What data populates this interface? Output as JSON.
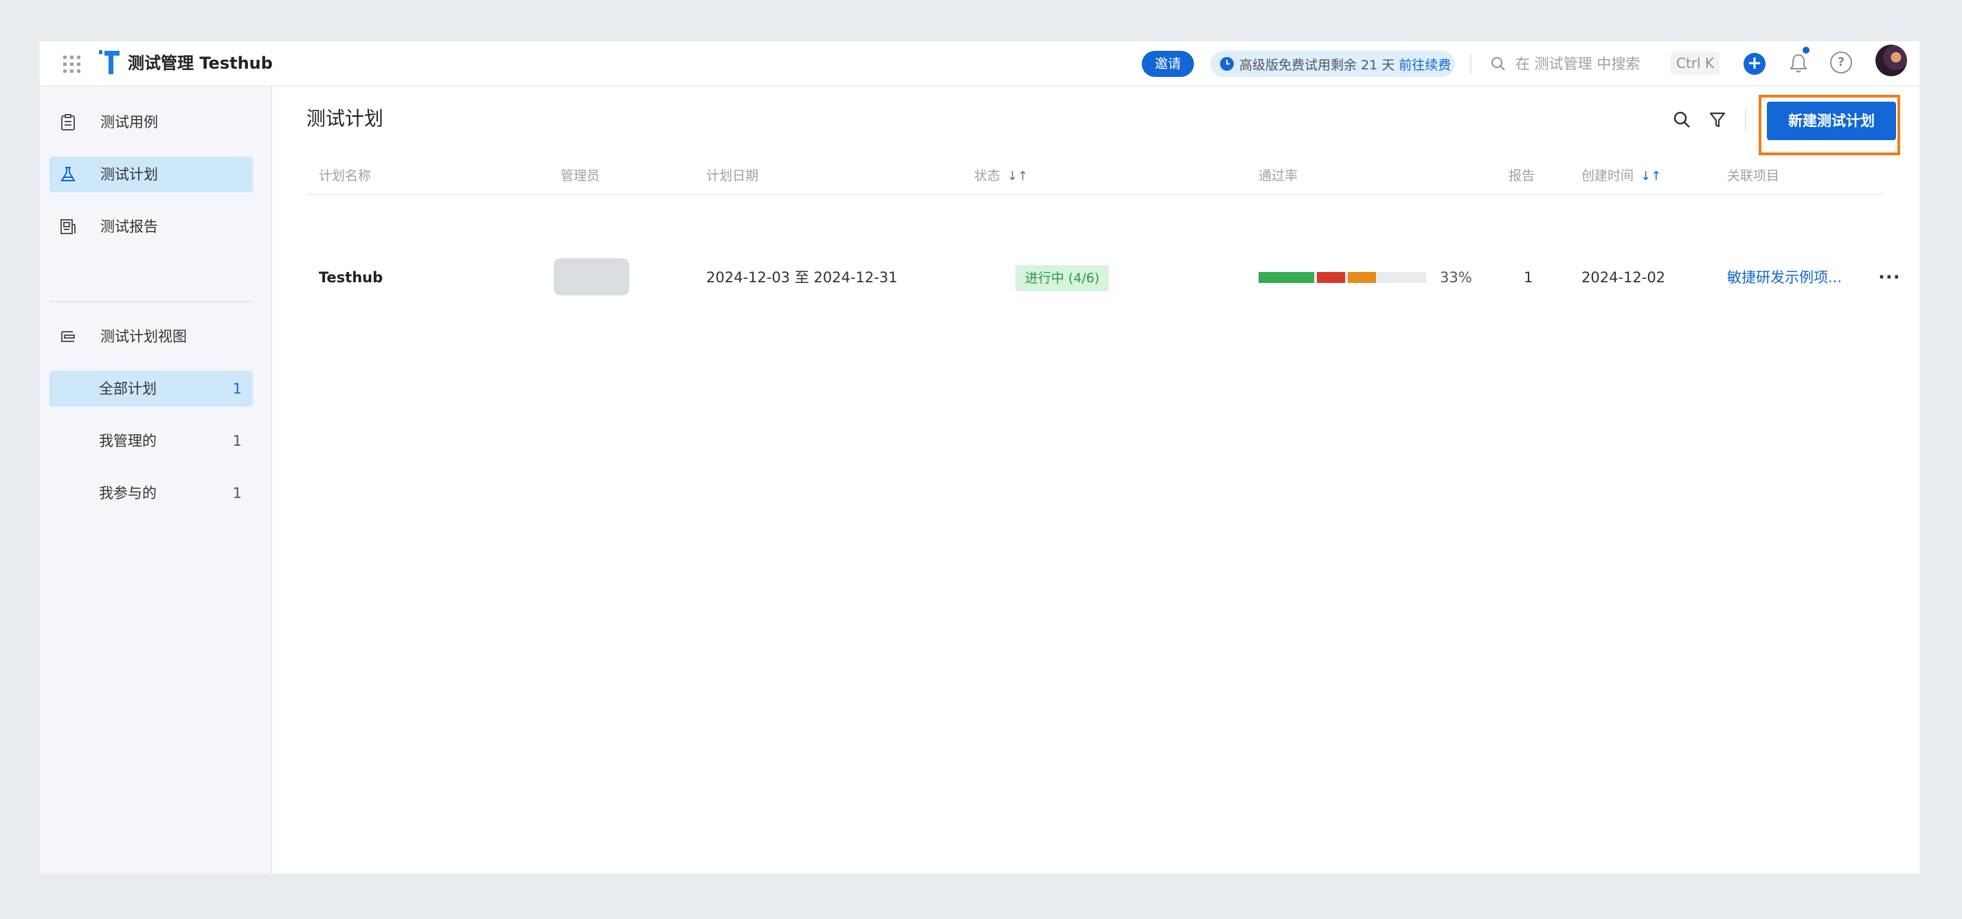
{
  "header": {
    "app_title": "测试管理 Testhub",
    "invite_label": "邀请",
    "trial_text": "高级版免费试用剩余 21 天",
    "trial_link": "前往续费",
    "search_placeholder": "在 测试管理 中搜索",
    "shortcut": "Ctrl K",
    "accent_color": "#1266d6"
  },
  "sidebar": {
    "items": [
      {
        "label": "测试用例",
        "icon": "clipboard-icon"
      },
      {
        "label": "测试计划",
        "icon": "flask-icon"
      },
      {
        "label": "测试报告",
        "icon": "report-icon"
      }
    ],
    "views_title": "测试计划视图",
    "views": [
      {
        "label": "全部计划",
        "count": "1"
      },
      {
        "label": "我管理的",
        "count": "1"
      },
      {
        "label": "我参与的",
        "count": "1"
      }
    ]
  },
  "main": {
    "title": "测试计划",
    "new_button": "新建测试计划",
    "columns": [
      "计划名称",
      "管理员",
      "计划日期",
      "状态",
      "通过率",
      "报告",
      "创建时间",
      "关联项目"
    ],
    "rows": [
      {
        "name": "Testhub",
        "date_range": "2024-12-03 至 2024-12-31",
        "status": "进行中 (4/6)",
        "pass_rate": "33%",
        "pass_segments": [
          {
            "color": "#36ad4f",
            "fraction": 0.33
          },
          {
            "color": "#d43a2c",
            "fraction": 0.17
          },
          {
            "color": "#e88a1a",
            "fraction": 0.17
          }
        ],
        "reports": "1",
        "created": "2024-12-02",
        "project": "敏捷研发示例项..."
      }
    ]
  }
}
